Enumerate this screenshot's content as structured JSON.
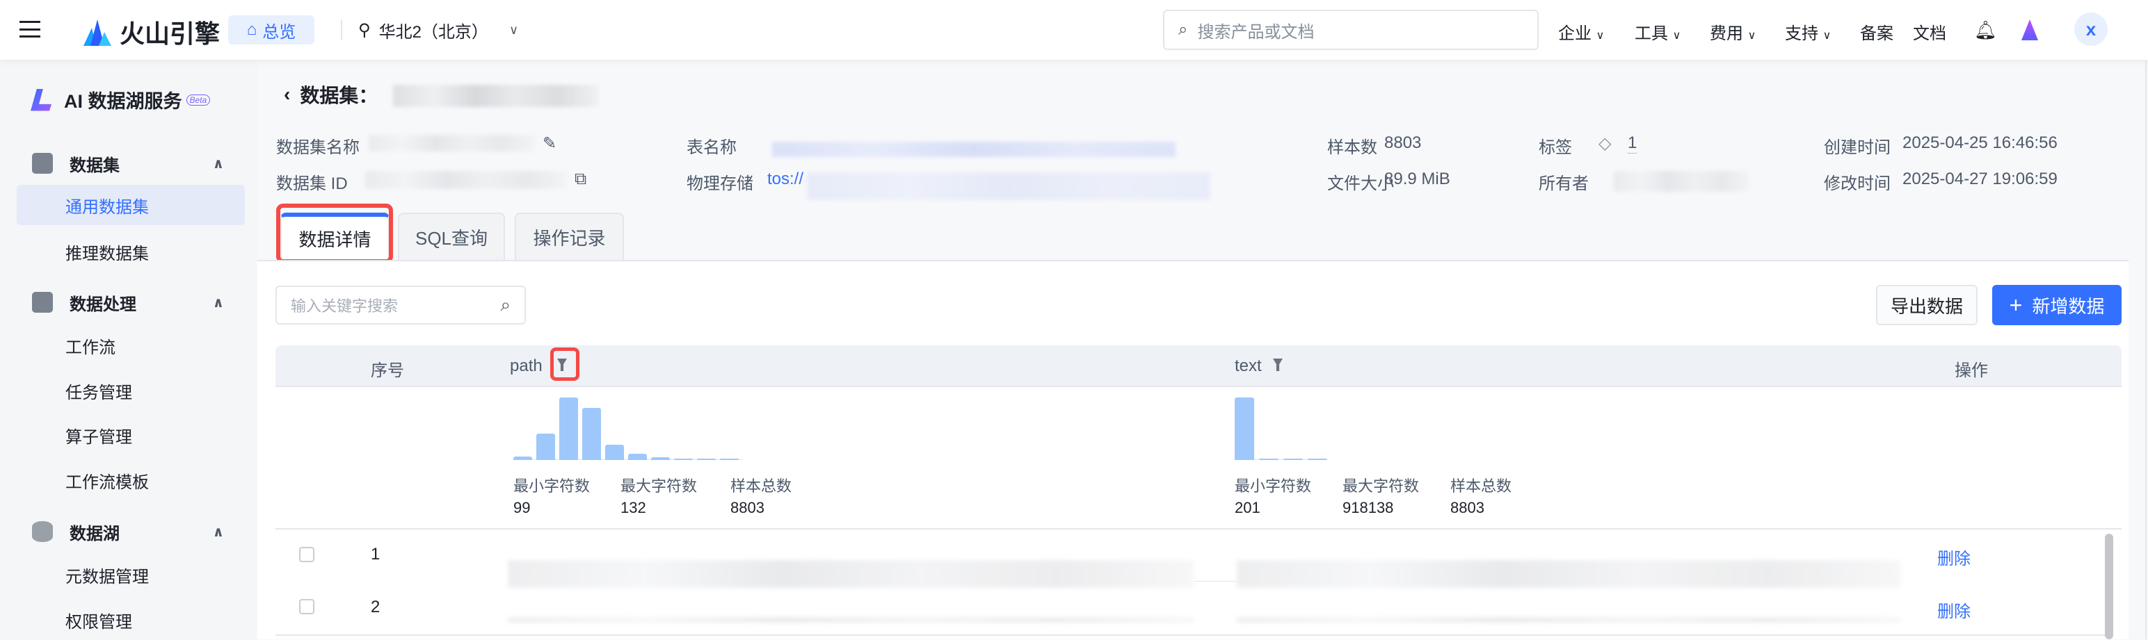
{
  "topbar": {
    "brand": "火山引擎",
    "overview": "总览",
    "region": "华北2（北京）",
    "search_placeholder": "搜索产品或文档",
    "nav": [
      "企业",
      "工具",
      "费用",
      "支持",
      "备案",
      "文档"
    ],
    "avatar": "x"
  },
  "sidebar": {
    "title": "AI 数据湖服务",
    "badge": "Beta",
    "groups": [
      {
        "label": "数据集",
        "items": [
          "通用数据集",
          "推理数据集"
        ]
      },
      {
        "label": "数据处理",
        "items": [
          "工作流",
          "任务管理",
          "算子管理",
          "工作流模板"
        ]
      },
      {
        "label": "数据湖",
        "items": [
          "元数据管理",
          "权限管理"
        ]
      }
    ]
  },
  "header": {
    "back_title": "数据集："
  },
  "info": {
    "name_label": "数据集名称",
    "id_label": "数据集 ID",
    "table_label": "表名称",
    "storage_label": "物理存储",
    "storage_prefix": "tos://",
    "samples_label": "样本数",
    "samples": "8803",
    "size_label": "文件大小",
    "size": "89.9 MiB",
    "tags_label": "标签",
    "tags": "1",
    "owner_label": "所有者",
    "created_label": "创建时间",
    "created": "2025-04-25 16:46:56",
    "modified_label": "修改时间",
    "modified": "2025-04-27 19:06:59"
  },
  "tabs": [
    "数据详情",
    "SQL查询",
    "操作记录"
  ],
  "toolbar": {
    "search_placeholder": "输入关键字搜索",
    "export": "导出数据",
    "add": "新增数据"
  },
  "table": {
    "headers": {
      "index": "序号",
      "path": "path",
      "text": "text",
      "ops": "操作"
    },
    "stats_labels": [
      "最小字符数",
      "最大字符数",
      "样本总数"
    ],
    "path_stats": [
      "99",
      "132",
      "8803"
    ],
    "text_stats": [
      "201",
      "918138",
      "8803"
    ],
    "path_hist": [
      6,
      42,
      100,
      83,
      25,
      10,
      5,
      1,
      1,
      1
    ],
    "text_hist": [
      100,
      1,
      1,
      1
    ],
    "rows": [
      {
        "index": "1",
        "action": "删除"
      },
      {
        "index": "2",
        "action": "删除"
      }
    ]
  },
  "colors": {
    "accent": "#3370ff",
    "hist": "#9ec7fb",
    "highlight": "#f54a45"
  }
}
